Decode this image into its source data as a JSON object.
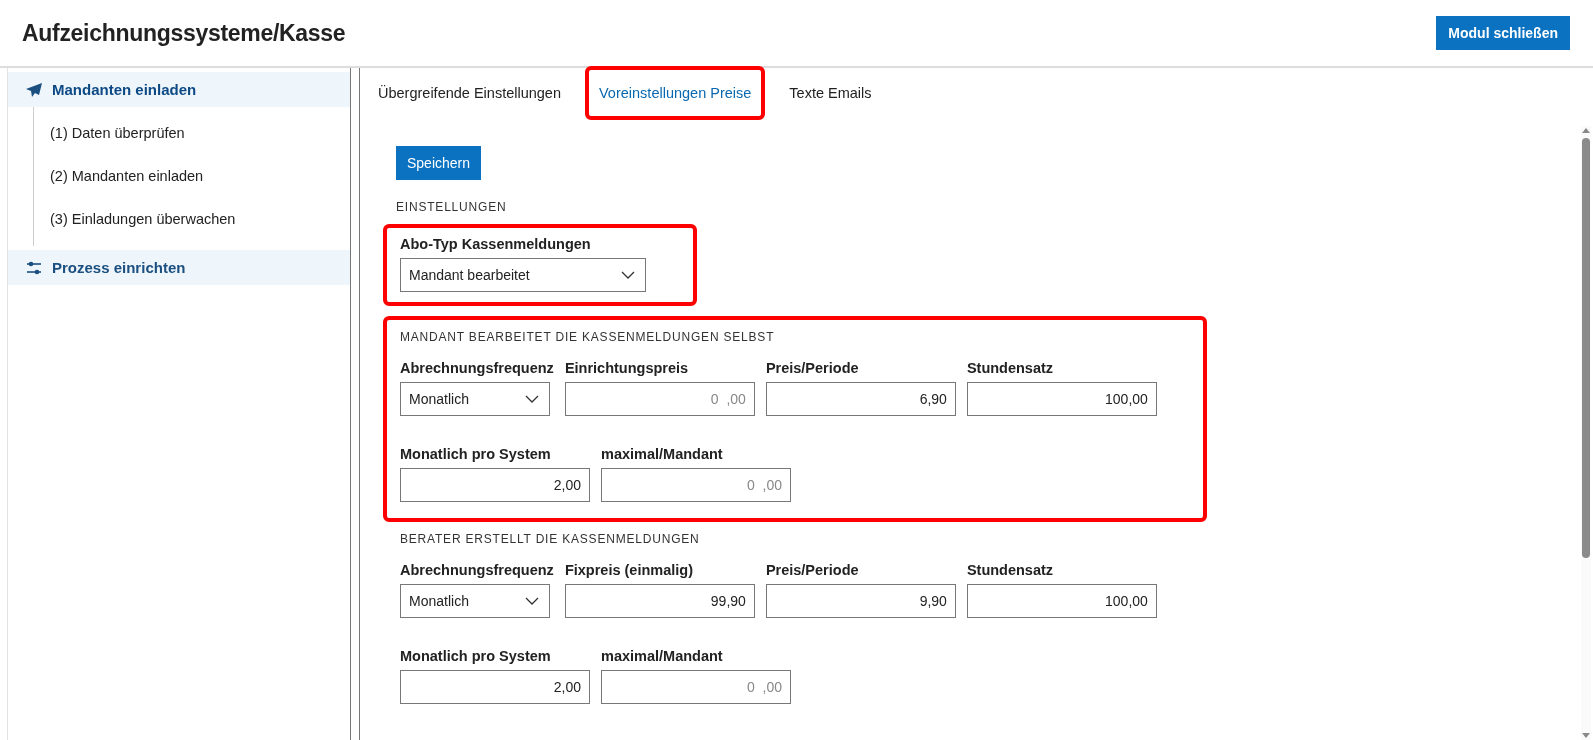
{
  "header": {
    "title": "Aufzeichnungssysteme/Kasse",
    "close_button": "Modul schließen"
  },
  "sidebar": {
    "items": [
      {
        "label": "Mandanten einladen",
        "selected": true,
        "children": [
          {
            "label": "(1) Daten überprüfen"
          },
          {
            "label": "(2) Mandanten einladen"
          },
          {
            "label": "(3) Einladungen überwachen"
          }
        ]
      },
      {
        "label": "Prozess einrichten",
        "selected": false
      }
    ]
  },
  "tabs": [
    {
      "label": "Übergreifende Einstellungen",
      "selected": false,
      "highlighted": false
    },
    {
      "label": "Voreinstellungen Preise",
      "selected": true,
      "highlighted": true
    },
    {
      "label": "Texte Emails",
      "selected": false,
      "highlighted": false
    }
  ],
  "save_button": "Speichern",
  "settings": {
    "heading": "EINSTELLUNGEN",
    "label": "Abo-Typ Kassenmeldungen",
    "value": "Mandant bearbeitet",
    "highlighted": true
  },
  "sections": [
    {
      "heading": "MANDANT BEARBEITET DIE KASSENMELDUNGEN SELBST",
      "highlighted": true,
      "rows": [
        [
          {
            "kind": "select",
            "label": "Abrechnungsfrequenz",
            "value": "Monatlich"
          },
          {
            "kind": "number",
            "label": "Einrichtungspreis",
            "placeholder": "0  ,00"
          },
          {
            "kind": "number",
            "label": "Preis/Periode",
            "value": "6,90"
          },
          {
            "kind": "number",
            "label": "Stundensatz",
            "value": "100,00"
          }
        ],
        [
          {
            "kind": "number",
            "label": "Monatlich pro System",
            "value": "2,00"
          },
          {
            "kind": "number",
            "label": "maximal/Mandant",
            "placeholder": "0  ,00"
          }
        ]
      ]
    },
    {
      "heading": "BERATER ERSTELLT DIE KASSENMELDUNGEN",
      "highlighted": false,
      "rows": [
        [
          {
            "kind": "select",
            "label": "Abrechnungsfrequenz",
            "value": "Monatlich"
          },
          {
            "kind": "number",
            "label": "Fixpreis (einmalig)",
            "value": "99,90"
          },
          {
            "kind": "number",
            "label": "Preis/Periode",
            "value": "9,90"
          },
          {
            "kind": "number",
            "label": "Stundensatz",
            "value": "100,00"
          }
        ],
        [
          {
            "kind": "number",
            "label": "Monatlich pro System",
            "value": "2,00"
          },
          {
            "kind": "number",
            "label": "maximal/Mandant",
            "placeholder": "0  ,00"
          }
        ]
      ]
    }
  ]
}
